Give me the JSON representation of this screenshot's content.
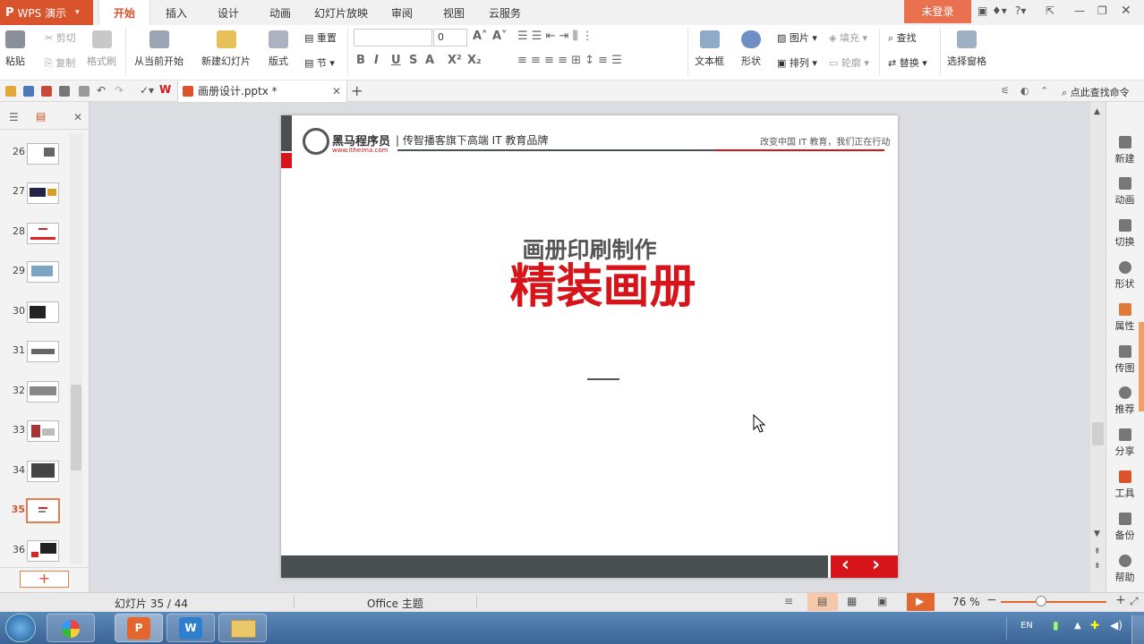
{
  "app": {
    "name": "WPS 演示",
    "login": "未登录"
  },
  "tabs": [
    "开始",
    "插入",
    "设计",
    "动画",
    "幻灯片放映",
    "审阅",
    "视图",
    "云服务"
  ],
  "ribbon": {
    "paste": "粘贴",
    "cut": "剪切",
    "copy": "复制",
    "format_painter": "格式刷",
    "from_current": "从当前开始",
    "new_slide": "新建幻灯片",
    "layout": "版式",
    "reset": "重置",
    "section": "节",
    "font_size": "0",
    "textbox": "文本框",
    "shape": "形状",
    "picture": "图片",
    "fill": "填充",
    "arrange": "排列",
    "outline": "轮廓",
    "find": "查找",
    "replace": "替换",
    "select_pane": "选择窗格"
  },
  "doc_tab": {
    "name": "画册设计.pptx *"
  },
  "search_command": "点此查找命令",
  "thumbnails": [
    "26",
    "27",
    "28",
    "29",
    "30",
    "31",
    "32",
    "33",
    "34",
    "35",
    "36"
  ],
  "selected_slide": "35",
  "slide": {
    "brand_name": "黑马程序员",
    "brand_url": "www.itheima.com",
    "tagline": "| 传智播客旗下高端 IT 教育品牌",
    "slogan": "改变中国 IT 教育，我们正在行动",
    "subtitle": "画册印刷制作",
    "title": "精装画册",
    "nav_prev": "‹",
    "nav_next": "›"
  },
  "right_sidebar": [
    "新建",
    "动画",
    "切换",
    "形状",
    "属性",
    "传图",
    "推荐",
    "分享",
    "工具",
    "备份",
    "帮助"
  ],
  "status": {
    "slide_counter": "幻灯片 35 / 44",
    "theme": "Office 主题",
    "zoom": "76 %"
  },
  "tray": {
    "lang": "EN"
  },
  "colors": {
    "accent": "#d9532c",
    "brand_red": "#d7141a",
    "dark_bar": "#4a4f51"
  }
}
